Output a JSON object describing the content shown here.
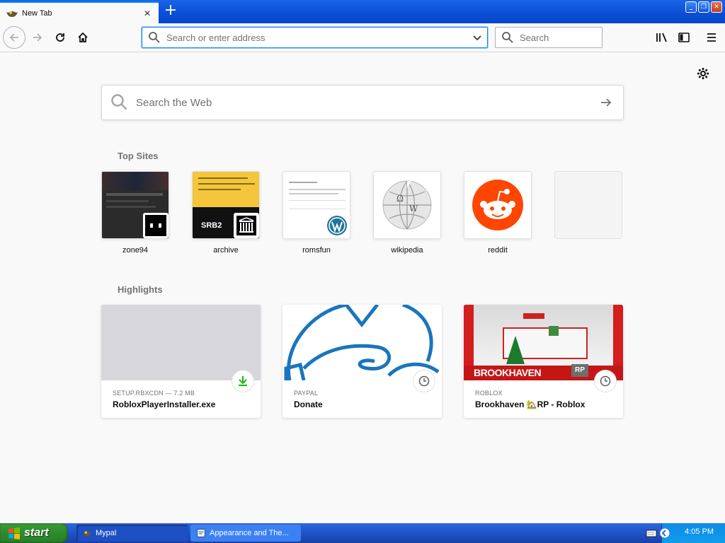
{
  "tab": {
    "title": "New Tab",
    "close_glyph": "✕"
  },
  "toolbar": {
    "newtab_glyph": "+",
    "url_placeholder": "Search or enter address",
    "search_placeholder": "Search"
  },
  "content": {
    "web_search_placeholder": "Search the Web",
    "top_sites_title": "Top Sites",
    "highlights_title": "Highlights",
    "top_sites": [
      {
        "label": "zone94"
      },
      {
        "label": "archive"
      },
      {
        "label": "romsfun"
      },
      {
        "label": "wikipedia"
      },
      {
        "label": "reddit"
      },
      {
        "label": ""
      }
    ],
    "highlights": [
      {
        "source": "SETUP.RBXCDN — 7.2 MB",
        "title": "RobloxPlayerInstaller.exe",
        "context_icon": "download-icon"
      },
      {
        "source": "PAYPAL",
        "title": "Donate",
        "context_icon": "clock-icon"
      },
      {
        "source": "ROBLOX",
        "title": "Brookhaven 🏡RP - Roblox",
        "context_icon": "clock-icon"
      }
    ],
    "brookhaven_logo_text": "BROOKHAVEN",
    "brookhaven_rp_badge": "RP",
    "srb2_text": "SRB2"
  },
  "taskbar": {
    "start_label": "start",
    "tasks": [
      {
        "label": "Mypal"
      },
      {
        "label": "Appearance and The..."
      }
    ],
    "time": "4:05 PM"
  },
  "colors": {
    "accent": "#0a84ff",
    "reddit": "#ff4500",
    "paypal_line": "#1a75bc",
    "download_green": "#12bc00"
  }
}
